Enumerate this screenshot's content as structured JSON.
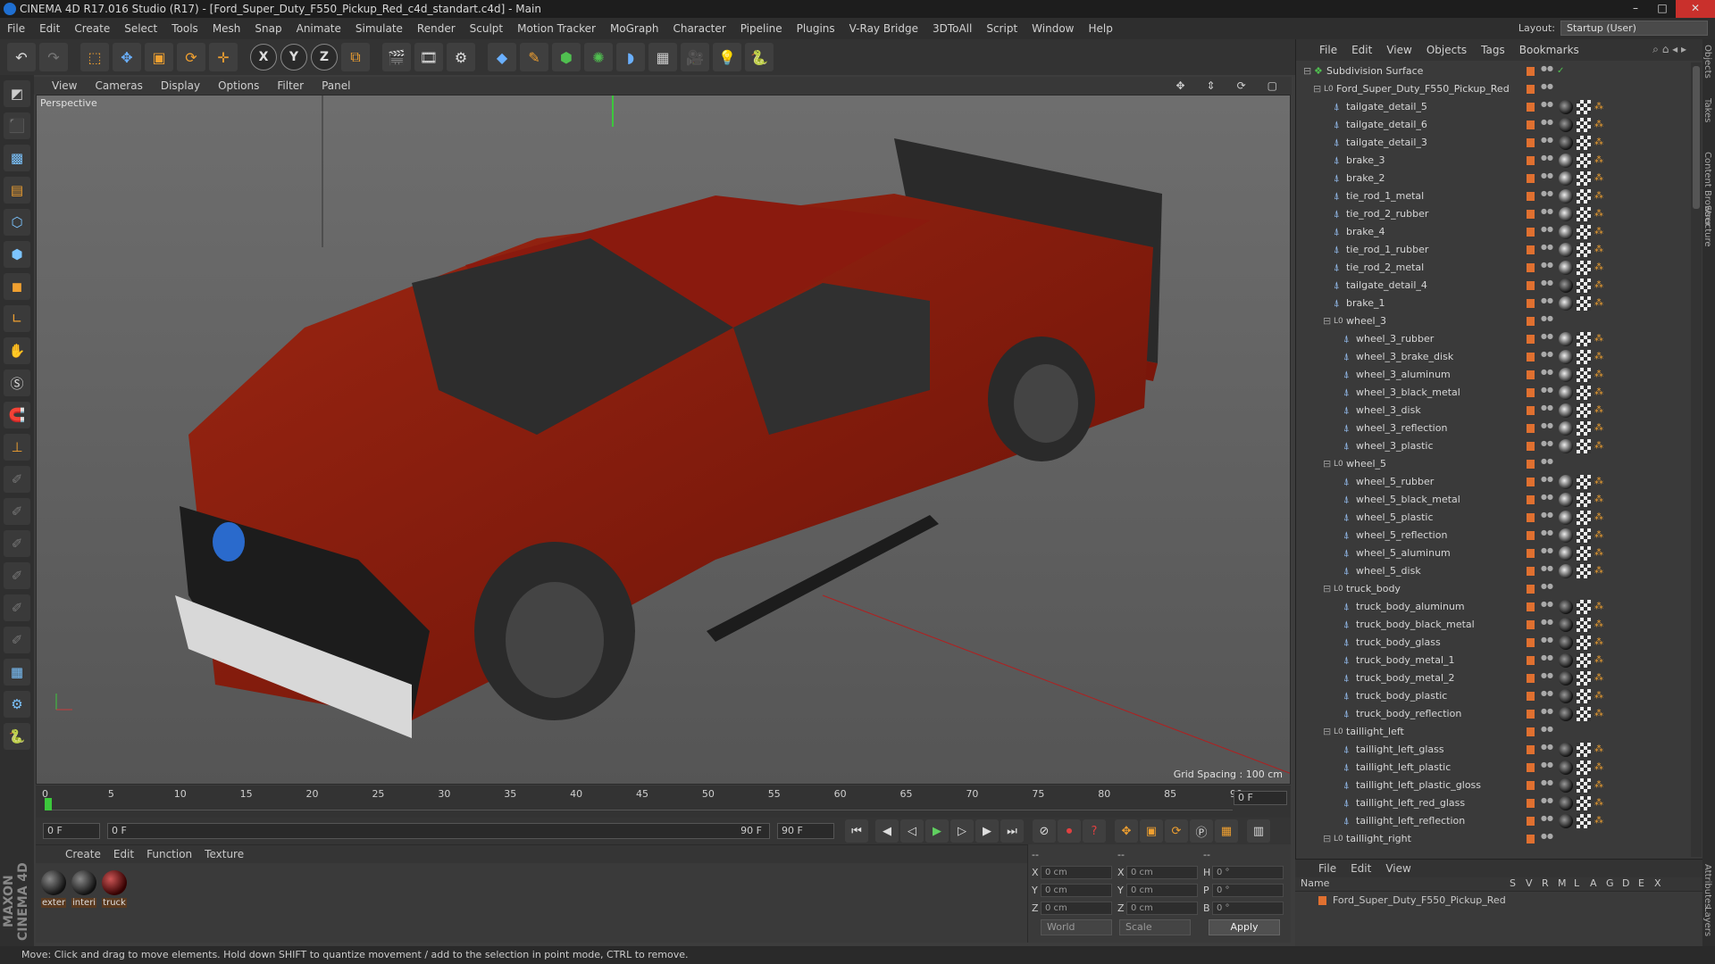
{
  "window": {
    "title": "CINEMA 4D R17.016 Studio (R17) - [Ford_Super_Duty_F550_Pickup_Red_c4d_standart.c4d] - Main"
  },
  "menu": [
    "File",
    "Edit",
    "Create",
    "Select",
    "Tools",
    "Mesh",
    "Snap",
    "Animate",
    "Simulate",
    "Render",
    "Sculpt",
    "Motion Tracker",
    "MoGraph",
    "Character",
    "Pipeline",
    "Plugins",
    "V-Ray Bridge",
    "3DToAll",
    "Script",
    "Window",
    "Help"
  ],
  "layout": {
    "label": "Layout:",
    "value": "Startup (User)"
  },
  "viewport": {
    "menu": [
      "View",
      "Cameras",
      "Display",
      "Options",
      "Filter",
      "Panel"
    ],
    "camera_label": "Perspective",
    "grid_spacing": "Grid Spacing : 100 cm"
  },
  "timeline": {
    "ticks": [
      "0",
      "5",
      "10",
      "15",
      "20",
      "25",
      "30",
      "35",
      "40",
      "45",
      "50",
      "55",
      "60",
      "65",
      "70",
      "75",
      "80",
      "85",
      "90"
    ],
    "current_frame": "0 F",
    "start_field": "0 F",
    "range_start": "0 F",
    "range_end": "90 F",
    "end_field": "90 F"
  },
  "material_manager": {
    "menu": [
      "Create",
      "Edit",
      "Function",
      "Texture"
    ],
    "materials": [
      {
        "label": "exter",
        "color": "dark"
      },
      {
        "label": "interi",
        "color": "dark"
      },
      {
        "label": "truck",
        "color": "red"
      }
    ]
  },
  "coordinates": {
    "header": [
      "--",
      "--",
      "--"
    ],
    "rows": [
      {
        "a": "X",
        "av": "0 cm",
        "b": "X",
        "bv": "0 cm",
        "c": "H",
        "cv": "0 °"
      },
      {
        "a": "Y",
        "av": "0 cm",
        "b": "Y",
        "bv": "0 cm",
        "c": "P",
        "cv": "0 °"
      },
      {
        "a": "Z",
        "av": "0 cm",
        "b": "Z",
        "bv": "0 cm",
        "c": "B",
        "cv": "0 °"
      }
    ],
    "mode": "World",
    "type": "Scale",
    "apply": "Apply"
  },
  "object_manager": {
    "menu": [
      "File",
      "Edit",
      "View",
      "Objects",
      "Tags",
      "Bookmarks"
    ],
    "objects": [
      {
        "name": "Subdivision Surface",
        "level": 0,
        "kind": "subd"
      },
      {
        "name": "Ford_Super_Duty_F550_Pickup_Red",
        "level": 1,
        "kind": "null"
      },
      {
        "name": "tailgate_detail_5",
        "level": 2,
        "kind": "poly",
        "tag": "dark"
      },
      {
        "name": "tailgate_detail_6",
        "level": 2,
        "kind": "poly",
        "tag": "dark"
      },
      {
        "name": "tailgate_detail_3",
        "level": 2,
        "kind": "poly",
        "tag": "dark"
      },
      {
        "name": "brake_3",
        "level": 2,
        "kind": "poly",
        "tag": "light"
      },
      {
        "name": "brake_2",
        "level": 2,
        "kind": "poly",
        "tag": "light"
      },
      {
        "name": "tie_rod_1_metal",
        "level": 2,
        "kind": "poly",
        "tag": "light"
      },
      {
        "name": "tie_rod_2_rubber",
        "level": 2,
        "kind": "poly",
        "tag": "light"
      },
      {
        "name": "brake_4",
        "level": 2,
        "kind": "poly",
        "tag": "light"
      },
      {
        "name": "tie_rod_1_rubber",
        "level": 2,
        "kind": "poly",
        "tag": "light"
      },
      {
        "name": "tie_rod_2_metal",
        "level": 2,
        "kind": "poly",
        "tag": "light"
      },
      {
        "name": "tailgate_detail_4",
        "level": 2,
        "kind": "poly",
        "tag": "dark"
      },
      {
        "name": "brake_1",
        "level": 2,
        "kind": "poly",
        "tag": "light"
      },
      {
        "name": "wheel_3",
        "level": 2,
        "kind": "null"
      },
      {
        "name": "wheel_3_rubber",
        "level": 3,
        "kind": "poly",
        "tag": "light"
      },
      {
        "name": "wheel_3_brake_disk",
        "level": 3,
        "kind": "poly",
        "tag": "light"
      },
      {
        "name": "wheel_3_aluminum",
        "level": 3,
        "kind": "poly",
        "tag": "light"
      },
      {
        "name": "wheel_3_black_metal",
        "level": 3,
        "kind": "poly",
        "tag": "light"
      },
      {
        "name": "wheel_3_disk",
        "level": 3,
        "kind": "poly",
        "tag": "light"
      },
      {
        "name": "wheel_3_reflection",
        "level": 3,
        "kind": "poly",
        "tag": "light"
      },
      {
        "name": "wheel_3_plastic",
        "level": 3,
        "kind": "poly",
        "tag": "light"
      },
      {
        "name": "wheel_5",
        "level": 2,
        "kind": "null"
      },
      {
        "name": "wheel_5_rubber",
        "level": 3,
        "kind": "poly",
        "tag": "light"
      },
      {
        "name": "wheel_5_black_metal",
        "level": 3,
        "kind": "poly",
        "tag": "light"
      },
      {
        "name": "wheel_5_plastic",
        "level": 3,
        "kind": "poly",
        "tag": "light"
      },
      {
        "name": "wheel_5_reflection",
        "level": 3,
        "kind": "poly",
        "tag": "light"
      },
      {
        "name": "wheel_5_aluminum",
        "level": 3,
        "kind": "poly",
        "tag": "light"
      },
      {
        "name": "wheel_5_disk",
        "level": 3,
        "kind": "poly",
        "tag": "light"
      },
      {
        "name": "truck_body",
        "level": 2,
        "kind": "null"
      },
      {
        "name": "truck_body_aluminum",
        "level": 3,
        "kind": "poly",
        "tag": "dark"
      },
      {
        "name": "truck_body_black_metal",
        "level": 3,
        "kind": "poly",
        "tag": "dark"
      },
      {
        "name": "truck_body_glass",
        "level": 3,
        "kind": "poly",
        "tag": "dark"
      },
      {
        "name": "truck_body_metal_1",
        "level": 3,
        "kind": "poly",
        "tag": "dark"
      },
      {
        "name": "truck_body_metal_2",
        "level": 3,
        "kind": "poly",
        "tag": "dark"
      },
      {
        "name": "truck_body_plastic",
        "level": 3,
        "kind": "poly",
        "tag": "dark"
      },
      {
        "name": "truck_body_reflection",
        "level": 3,
        "kind": "poly",
        "tag": "dark"
      },
      {
        "name": "taillight_left",
        "level": 2,
        "kind": "null"
      },
      {
        "name": "taillight_left_glass",
        "level": 3,
        "kind": "poly",
        "tag": "dark"
      },
      {
        "name": "taillight_left_plastic",
        "level": 3,
        "kind": "poly",
        "tag": "dark"
      },
      {
        "name": "taillight_left_plastic_gloss",
        "level": 3,
        "kind": "poly",
        "tag": "dark"
      },
      {
        "name": "taillight_left_red_glass",
        "level": 3,
        "kind": "poly",
        "tag": "dark"
      },
      {
        "name": "taillight_left_reflection",
        "level": 3,
        "kind": "poly",
        "tag": "dark"
      },
      {
        "name": "taillight_right",
        "level": 2,
        "kind": "null"
      }
    ]
  },
  "side_tabs": [
    "Objects",
    "Takes",
    "Content Browser",
    "Structure"
  ],
  "side_tabs_bottom": [
    "Attributes",
    "Layers"
  ],
  "attribute_manager": {
    "menu": [
      "File",
      "Edit",
      "View"
    ],
    "header_name": "Name",
    "header_cols": [
      "S",
      "V",
      "R",
      "M",
      "L",
      "A",
      "G",
      "D",
      "E",
      "X"
    ],
    "row_name": "Ford_Super_Duty_F550_Pickup_Red"
  },
  "status": "Move: Click and drag to move elements. Hold down SHIFT to quantize movement / add to the selection in point mode, CTRL to remove.",
  "colors": {
    "accent": "#f0a030",
    "truck": "#8a1a0e",
    "object_icon": "#9cc8ff"
  }
}
